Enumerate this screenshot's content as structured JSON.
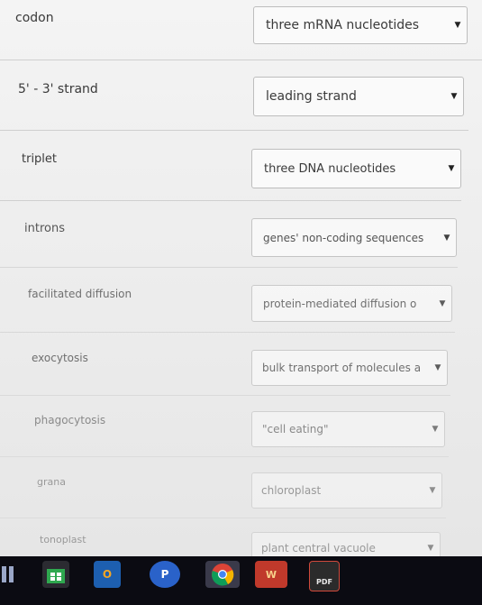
{
  "rows": [
    {
      "term": "codon",
      "answer": "three mRNA nucleotides"
    },
    {
      "term": "5' - 3' strand",
      "answer": "leading strand"
    },
    {
      "term": "triplet",
      "answer": "three DNA nucleotides"
    },
    {
      "term": "introns",
      "answer": "genes' non-coding sequences"
    },
    {
      "term": "facilitated diffusion",
      "answer": "protein-mediated diffusion o"
    },
    {
      "term": "exocytosis",
      "answer": "bulk transport of molecules a"
    },
    {
      "term": "phagocytosis",
      "answer": "\"cell eating\""
    },
    {
      "term": "grana",
      "answer": "chloroplast"
    },
    {
      "term": "tonoplast",
      "answer": "plant central vacuole"
    }
  ],
  "dropdown_arrow": "▼",
  "taskbar": {
    "icons": [
      "task-view-icon",
      "store-icon",
      "outlook-icon",
      "publisher-icon",
      "chrome-icon",
      "word-icon",
      "pdf-icon"
    ],
    "publisher_letter": "P",
    "word_letter": "W",
    "outlook_letter": "O",
    "pdf_label": "PDF"
  },
  "colors": {
    "taskbar": "#0b0b12",
    "page": "#eeeeee"
  }
}
